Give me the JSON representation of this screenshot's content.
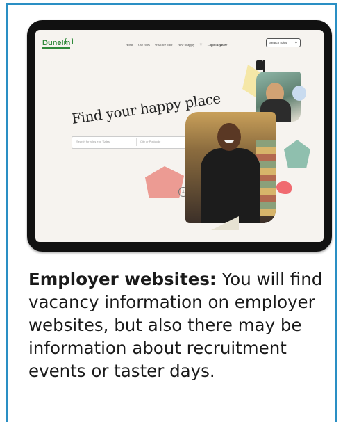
{
  "accent_color": "#2a8fc4",
  "website": {
    "logo": "Dunelm",
    "nav_links": [
      "Home",
      "Our roles",
      "What we offer",
      "How to apply",
      "♡",
      "Login/Register"
    ],
    "search_button": "Search roles",
    "headline": "Find your happy place",
    "search_keyword_placeholder": "Search for roles e.g. 'Sales'",
    "search_location_placeholder": "City or Postcode",
    "search_icon": "search-icon"
  },
  "caption": {
    "heading": "Employer websites:",
    "body": " You will find vacancy information on employer websites, but also there may be information about recruitment events or taster days."
  }
}
